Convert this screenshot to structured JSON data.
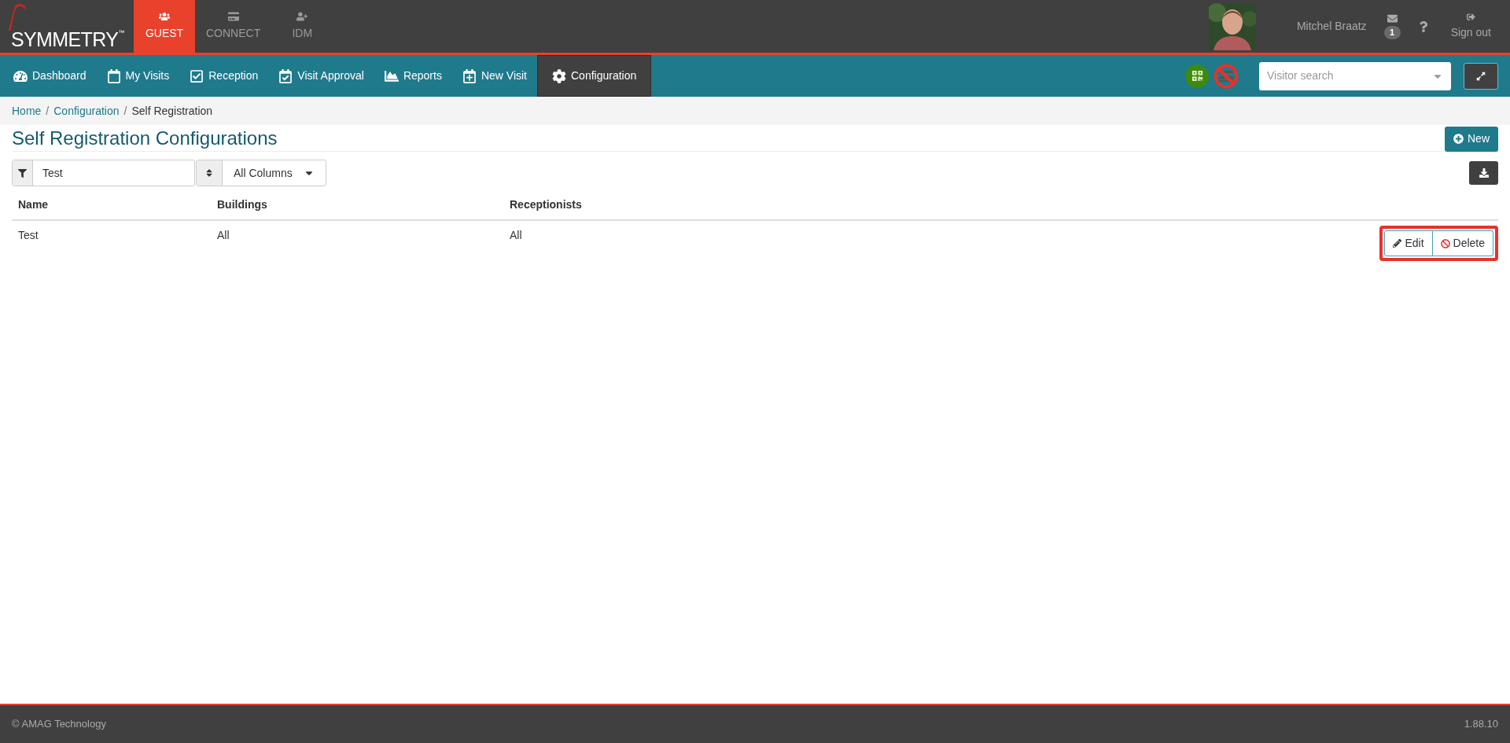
{
  "logo": {
    "text": "SYMMETRY",
    "mark": "™"
  },
  "modules": [
    {
      "label": "GUEST",
      "selected": true
    },
    {
      "label": "CONNECT",
      "selected": false
    },
    {
      "label": "IDM",
      "selected": false
    }
  ],
  "user": {
    "name": "Mitchel Braatz",
    "messages_count": "1",
    "sign_out": "Sign out"
  },
  "nav": [
    {
      "label": "Dashboard",
      "selected": false
    },
    {
      "label": "My Visits",
      "selected": false
    },
    {
      "label": "Reception",
      "selected": false
    },
    {
      "label": "Visit Approval",
      "selected": false
    },
    {
      "label": "Reports",
      "selected": false
    },
    {
      "label": "New Visit",
      "selected": false
    },
    {
      "label": "Configuration",
      "selected": true
    }
  ],
  "visitor_search": {
    "placeholder": "Visitor search"
  },
  "breadcrumb_separator": "/",
  "breadcrumb": [
    {
      "label": "Home",
      "kind": "link"
    },
    {
      "label": "Configuration",
      "kind": "link"
    },
    {
      "label": "Self Registration",
      "kind": "current"
    }
  ],
  "page_title": "Self Registration Configurations",
  "new_button": "New",
  "filter": {
    "value": "Test",
    "column": "All Columns"
  },
  "table": {
    "columns": [
      "Name",
      "Buildings",
      "Receptionists"
    ],
    "rows": [
      {
        "cells": [
          "Test",
          "All",
          "All"
        ],
        "actions": [
          "Edit",
          "Delete"
        ]
      }
    ]
  },
  "footer": {
    "copyright": "© AMAG Technology",
    "version": "1.88.10"
  }
}
